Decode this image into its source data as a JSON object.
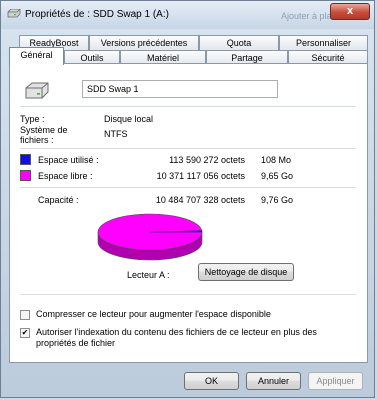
{
  "window": {
    "title": "Propriétés de : SDD Swap 1 (A:)",
    "ghost_text": "Ajouter à pla...",
    "close_glyph": "x"
  },
  "tabs": {
    "row1": [
      "ReadyBoost",
      "Versions précédentes",
      "Quota",
      "Personnaliser"
    ],
    "row2": [
      "Général",
      "Outils",
      "Matériel",
      "Partage",
      "Sécurité"
    ],
    "active": "Général"
  },
  "general": {
    "drive_name": "SDD Swap 1",
    "type_label": "Type :",
    "type_value": "Disque local",
    "fs_label_line1": "Système de",
    "fs_label_line2": "fichiers :",
    "fs_value": "NTFS",
    "used_label": "Espace utilisé :",
    "used_bytes": "113 590 272 octets",
    "used_human": "108 Mo",
    "free_label": "Espace libre :",
    "free_bytes": "10 371 117 056 octets",
    "free_human": "9,65 Go",
    "capacity_label": "Capacité :",
    "capacity_bytes": "10 484 707 328 octets",
    "capacity_human": "9,76 Go",
    "drive_label": "Lecteur A :",
    "cleanup_button": "Nettoyage de disque",
    "compress_label": "Compresser ce lecteur pour augmenter l'espace disponible",
    "compress_checked": false,
    "index_label_line1": "Autoriser l'indexation du contenu des fichiers de ce lecteur en plus des",
    "index_label_line2": "propriétés de fichier",
    "index_checked": true
  },
  "colors": {
    "used": "#1010e0",
    "free": "#ff00ff"
  },
  "usage": {
    "used_fraction": 0.0108,
    "free_fraction": 0.9892
  },
  "buttons": {
    "ok": "OK",
    "cancel": "Annuler",
    "apply": "Appliquer"
  },
  "icons": {
    "title": "drive-icon",
    "drive": "hard-drive-icon",
    "check": "✔"
  }
}
